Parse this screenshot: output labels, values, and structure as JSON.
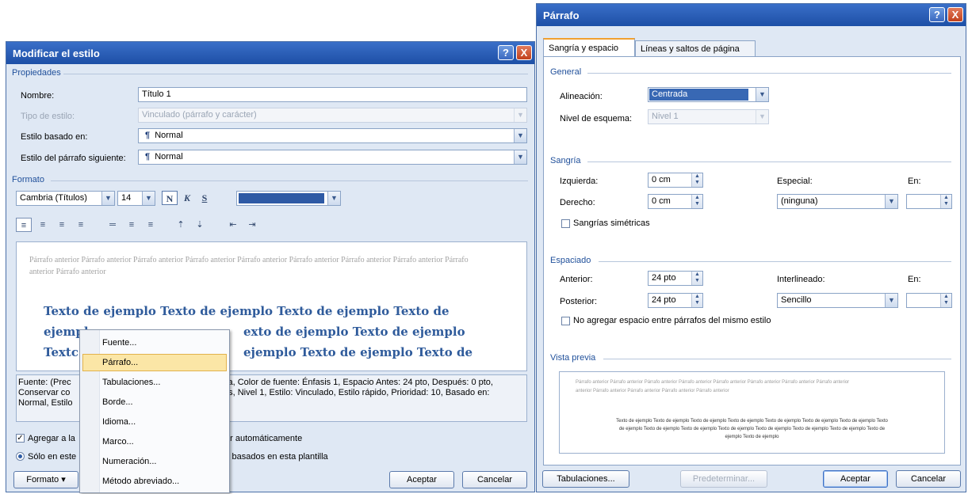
{
  "colors": {
    "title_bar": "#2a5cb4",
    "section_header": "#1f4f9a",
    "sample_text": "#2f5b9b",
    "menu_highlight": "#fbe6a6",
    "font_color_swatch": "#2e5aa5"
  },
  "left": {
    "title": "Modificar el estilo",
    "help_btn": "?",
    "close_btn": "X",
    "props_header": "Propiedades",
    "nombre_label": "Nombre:",
    "nombre_value": "Título 1",
    "tipo_label": "Tipo de estilo:",
    "tipo_value": "Vinculado (párrafo y carácter)",
    "basado_label": "Estilo basado en:",
    "basado_value": "Normal",
    "siguiente_label": "Estilo del párrafo siguiente:",
    "siguiente_value": "Normal",
    "paragraph_mark": "¶",
    "format_header": "Formato",
    "font_value": "Cambria (Títulos)",
    "size_value": "14",
    "bold_glyph": "N",
    "italic_glyph": "K",
    "underline_glyph": "S",
    "preview_prev": "Párrafo anterior Párrafo anterior Párrafo anterior Párrafo anterior Párrafo anterior Párrafo anterior Párrafo anterior Párrafo anterior Párrafo anterior Párrafo anterior",
    "sample_line1": "Texto de ejemplo Texto de ejemplo Texto de ejemplo Texto de",
    "sample_line2_a": "ejempl",
    "sample_line2_b": "exto de ejemplo Texto de ejemplo",
    "sample_line3_a": "Textc",
    "sample_line3_b": "ejemplo Texto de ejemplo Texto de",
    "desc_line1_a": "Fuente: (Prec",
    "desc_line1_b": "ca, Color de fuente: Énfasis 1, Espacio Antes:  24 pto, Después:  0 pto,",
    "desc_line2_a": "Conservar co",
    "desc_line2_b": "as, Nivel 1, Estilo: Vinculado, Estilo rápido, Prioridad: 10, Basado en:",
    "desc_line3_a": "Normal, Estilo",
    "add_label_a": "Agregar a la",
    "add_label_b": "ar automáticamente",
    "only_label_a": "Sólo en este",
    "only_label_b": "s basados en esta plantilla",
    "formato_btn": "Formato ▾",
    "aceptar": "Aceptar",
    "cancelar": "Cancelar",
    "menu": [
      "Fuente...",
      "Párrafo...",
      "Tabulaciones...",
      "Borde...",
      "Idioma...",
      "Marco...",
      "Numeración...",
      "Método abreviado..."
    ],
    "menu_selected_index": 1
  },
  "right": {
    "title": "Párrafo",
    "help_btn": "?",
    "close_btn": "X",
    "tab1": "Sangría y espacio",
    "tab2": "Líneas y saltos de página",
    "general_header": "General",
    "alineacion_label": "Alineación:",
    "alineacion_value": "Centrada",
    "nivel_label": "Nivel de esquema:",
    "nivel_value": "Nivel 1",
    "sangria_header": "Sangría",
    "izquierda_label": "Izquierda:",
    "izquierda_value": "0 cm",
    "derecho_label": "Derecho:",
    "derecho_value": "0 cm",
    "especial_label": "Especial:",
    "especial_value": "(ninguna)",
    "en_label": "En:",
    "simetricas_label": "Sangrías simétricas",
    "espaciado_header": "Espaciado",
    "anterior_label": "Anterior:",
    "anterior_value": "24 pto",
    "posterior_label": "Posterior:",
    "posterior_value": "24 pto",
    "interlineado_label": "Interlineado:",
    "interlineado_value": "Sencillo",
    "en2_label": "En:",
    "no_agregar_label": "No agregar espacio entre párrafos del mismo estilo",
    "vista_header": "Vista previa",
    "vp_prev1": "Párrafo anterior Párrafo anterior Párrafo anterior Párrafo anterior Párrafo anterior Párrafo anterior Párrafo anterior Párrafo anterior",
    "vp_prev2": "anterior Párrafo anterior Párrafo anterior Párrafo anterior Párrafo anterior",
    "vp_s1": "Texto de ejemplo Texto de ejemplo Texto de ejemplo Texto de ejemplo Texto de ejemplo Texto de ejemplo Texto de ejemplo Texto",
    "vp_s2": "de ejemplo Texto de ejemplo Texto de ejemplo Texto de ejemplo Texto de ejemplo Texto de ejemplo Texto de ejemplo Texto de",
    "vp_s3": "ejemplo Texto de ejemplo",
    "tabulaciones_btn": "Tabulaciones...",
    "predeterminar_btn": "Predeterminar...",
    "aceptar": "Aceptar",
    "cancelar": "Cancelar"
  }
}
